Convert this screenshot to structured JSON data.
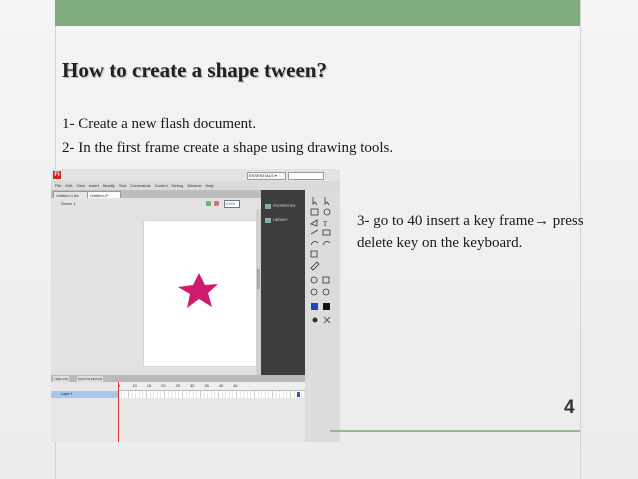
{
  "slide": {
    "title": "How to create a shape tween?",
    "step1": "1- Create a new flash document.",
    "step2": "2- In the first frame create a shape using drawing tools.",
    "step3": "3- go to 40  insert a key frame→ press delete key on the keyboard.",
    "page_number": "4"
  },
  "colors": {
    "accent_green": "#7fac7f",
    "star_color": "#d01a6e",
    "panel_dark": "#3d3d3d",
    "layer_blue": "#a8c6ee"
  },
  "flash_screenshot": {
    "logo": "Fl",
    "workspace": "ESSENTIALS ▾",
    "menu": [
      "File",
      "Edit",
      "View",
      "Insert",
      "Modify",
      "Text",
      "Commands",
      "Control",
      "Debug",
      "Window",
      "Help"
    ],
    "tabs": [
      "Untitled-1.fla",
      "Untitled-2*"
    ],
    "scene": "Scene 1",
    "zoom": "100%",
    "panel_items": [
      "PROPERTIES",
      "LIBRARY"
    ],
    "timeline_tabs": [
      "TIMELINE",
      "MOTION EDITOR"
    ],
    "layer_name": "Layer 1",
    "frame_ruler": [
      "5",
      "10",
      "15",
      "20",
      "25",
      "30",
      "35",
      "40",
      "45"
    ],
    "stage_shape": "star-icon"
  }
}
